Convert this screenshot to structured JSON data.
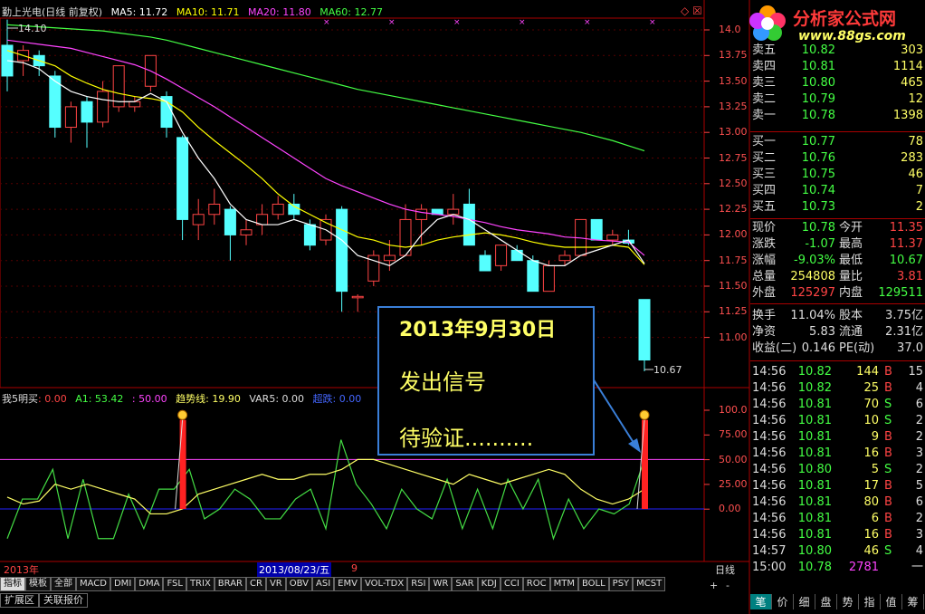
{
  "header": {
    "title": "勤上光电(日线 前复权)",
    "ma5": "MA5: 11.72",
    "ma10": "MA10: 11.71",
    "ma20": "MA20: 11.80",
    "ma60": "MA60: 12.77",
    "colors": {
      "ma5": "#ffffff",
      "ma10": "#ffff00",
      "ma20": "#ff44ff",
      "ma60": "#44ff44"
    }
  },
  "logo": {
    "name": "分析家公式网",
    "url": "www.88gs.com"
  },
  "indicator": {
    "name": "我5明买",
    "v1": ": 0.00",
    "a1": "A1: 53.42",
    "v2": ": 50.00",
    "trend": "趋势线: 19.90",
    "var5": "VAR5: 0.00",
    "other": "超跌: 0.00"
  },
  "price_axis": [
    "14.0",
    "13.75",
    "13.50",
    "13.25",
    "13.00",
    "12.75",
    "12.50",
    "12.25",
    "12.00",
    "11.75",
    "11.50",
    "11.25",
    "11.00"
  ],
  "ind_axis": [
    "100.0",
    "75.00",
    "50.00",
    "25.00",
    "0.00"
  ],
  "annotations": {
    "high": "14.10",
    "low": "10.67"
  },
  "note": {
    "line1": "2013年9月30日",
    "line2": "发出信号",
    "line3": "待验证.........."
  },
  "bottom": {
    "year": "2013年",
    "date": "2013/08/23/五",
    "mark": "9",
    "period": "日线",
    "plus": "+",
    "minus": "-"
  },
  "tabs": [
    "指标",
    "模板",
    "全部",
    "MACD",
    "DMI",
    "DMA",
    "FSL",
    "TRIX",
    "BRAR",
    "CR",
    "VR",
    "OBV",
    "ASI",
    "EMV",
    "VOL-TDX",
    "RSI",
    "WR",
    "SAR",
    "KDJ",
    "CCI",
    "ROC",
    "MTM",
    "BOLL",
    "PSY",
    "MCST"
  ],
  "tabs2": [
    "扩展区",
    "关联报价"
  ],
  "rtabs": [
    "笔",
    "价",
    "细",
    "盘",
    "势",
    "指",
    "值",
    "筹"
  ],
  "sells": [
    {
      "l": "卖五",
      "p": "10.82",
      "v": "303"
    },
    {
      "l": "卖四",
      "p": "10.81",
      "v": "1114"
    },
    {
      "l": "卖三",
      "p": "10.80",
      "v": "465"
    },
    {
      "l": "卖二",
      "p": "10.79",
      "v": "12"
    },
    {
      "l": "卖一",
      "p": "10.78",
      "v": "1398"
    }
  ],
  "buys": [
    {
      "l": "买一",
      "p": "10.77",
      "v": "78"
    },
    {
      "l": "买二",
      "p": "10.76",
      "v": "283"
    },
    {
      "l": "买三",
      "p": "10.75",
      "v": "46"
    },
    {
      "l": "买四",
      "p": "10.74",
      "v": "7"
    },
    {
      "l": "买五",
      "p": "10.73",
      "v": "2"
    }
  ],
  "quote": [
    {
      "l1": "现价",
      "v1": "10.78",
      "l2": "今开",
      "v2": "11.35",
      "c1": "#44ff44",
      "c2": "#ff4444"
    },
    {
      "l1": "涨跌",
      "v1": "-1.07",
      "l2": "最高",
      "v2": "11.37",
      "c1": "#44ff44",
      "c2": "#ff4444"
    },
    {
      "l1": "涨幅",
      "v1": "-9.03%",
      "l2": "最低",
      "v2": "10.67",
      "c1": "#44ff44",
      "c2": "#44ff44"
    },
    {
      "l1": "总量",
      "v1": "254808",
      "l2": "量比",
      "v2": "3.81",
      "c1": "#ffff66",
      "c2": "#ff4444"
    },
    {
      "l1": "外盘",
      "v1": "125297",
      "l2": "内盘",
      "v2": "129511",
      "c1": "#ff4444",
      "c2": "#44ff44"
    }
  ],
  "quote2": [
    {
      "l1": "换手",
      "v1": "11.04%",
      "l2": "股本",
      "v2": "3.75亿"
    },
    {
      "l1": "净资",
      "v1": "5.83",
      "l2": "流通",
      "v2": "2.31亿"
    },
    {
      "l1": "收益(二)",
      "v1": "0.146",
      "l2": "PE(动)",
      "v2": "37.0"
    }
  ],
  "ticks": [
    {
      "t": "14:56",
      "p": "10.82",
      "v": "144",
      "bs": "B",
      "n": "15"
    },
    {
      "t": "14:56",
      "p": "10.82",
      "v": "25",
      "bs": "B",
      "n": "4"
    },
    {
      "t": "14:56",
      "p": "10.81",
      "v": "70",
      "bs": "S",
      "n": "6"
    },
    {
      "t": "14:56",
      "p": "10.81",
      "v": "10",
      "bs": "S",
      "n": "2"
    },
    {
      "t": "14:56",
      "p": "10.81",
      "v": "9",
      "bs": "B",
      "n": "2"
    },
    {
      "t": "14:56",
      "p": "10.81",
      "v": "16",
      "bs": "B",
      "n": "3"
    },
    {
      "t": "14:56",
      "p": "10.80",
      "v": "5",
      "bs": "S",
      "n": "2"
    },
    {
      "t": "14:56",
      "p": "10.81",
      "v": "17",
      "bs": "B",
      "n": "5"
    },
    {
      "t": "14:56",
      "p": "10.81",
      "v": "80",
      "bs": "B",
      "n": "6"
    },
    {
      "t": "14:56",
      "p": "10.81",
      "v": "6",
      "bs": "B",
      "n": "2"
    },
    {
      "t": "14:56",
      "p": "10.81",
      "v": "16",
      "bs": "B",
      "n": "3"
    },
    {
      "t": "14:57",
      "p": "10.80",
      "v": "46",
      "bs": "S",
      "n": "4"
    },
    {
      "t": "15:00",
      "p": "10.78",
      "v": "2781",
      "bs": "",
      "n": "一"
    }
  ],
  "chart_data": {
    "type": "candlestick",
    "price_range": [
      10.6,
      14.15
    ],
    "candles": [
      {
        "o": 13.85,
        "h": 14.1,
        "l": 13.4,
        "c": 13.55
      },
      {
        "o": 13.7,
        "h": 13.85,
        "l": 13.55,
        "c": 13.8
      },
      {
        "o": 13.75,
        "h": 13.8,
        "l": 13.55,
        "c": 13.65
      },
      {
        "o": 13.55,
        "h": 13.6,
        "l": 12.95,
        "c": 13.05
      },
      {
        "o": 13.05,
        "h": 13.3,
        "l": 12.9,
        "c": 13.25
      },
      {
        "o": 13.3,
        "h": 13.35,
        "l": 12.85,
        "c": 13.1
      },
      {
        "o": 13.1,
        "h": 13.5,
        "l": 13.05,
        "c": 13.4
      },
      {
        "o": 13.25,
        "h": 13.65,
        "l": 13.2,
        "c": 13.65
      },
      {
        "o": 13.25,
        "h": 13.35,
        "l": 13.2,
        "c": 13.3
      },
      {
        "o": 13.45,
        "h": 13.75,
        "l": 13.4,
        "c": 13.75
      },
      {
        "o": 13.35,
        "h": 13.4,
        "l": 12.95,
        "c": 13.05
      },
      {
        "o": 12.95,
        "h": 12.97,
        "l": 11.95,
        "c": 12.15
      },
      {
        "o": 12.1,
        "h": 12.35,
        "l": 11.95,
        "c": 12.2
      },
      {
        "o": 12.2,
        "h": 12.45,
        "l": 12.1,
        "c": 12.3
      },
      {
        "o": 12.25,
        "h": 12.28,
        "l": 11.75,
        "c": 12.0
      },
      {
        "o": 12.0,
        "h": 12.15,
        "l": 11.9,
        "c": 12.05
      },
      {
        "o": 12.1,
        "h": 12.3,
        "l": 12.0,
        "c": 12.2
      },
      {
        "o": 12.2,
        "h": 12.38,
        "l": 12.15,
        "c": 12.3
      },
      {
        "o": 12.3,
        "h": 12.4,
        "l": 12.15,
        "c": 12.2
      },
      {
        "o": 12.1,
        "h": 12.15,
        "l": 11.85,
        "c": 11.9
      },
      {
        "o": 11.95,
        "h": 12.2,
        "l": 11.9,
        "c": 12.15
      },
      {
        "o": 12.25,
        "h": 12.28,
        "l": 11.25,
        "c": 11.45
      },
      {
        "o": 11.4,
        "h": 11.42,
        "l": 11.25,
        "c": 11.4
      },
      {
        "o": 11.55,
        "h": 11.85,
        "l": 11.5,
        "c": 11.8
      },
      {
        "o": 11.75,
        "h": 11.95,
        "l": 11.65,
        "c": 11.8
      },
      {
        "o": 11.8,
        "h": 12.3,
        "l": 11.8,
        "c": 12.15
      },
      {
        "o": 12.15,
        "h": 12.3,
        "l": 11.9,
        "c": 12.25
      },
      {
        "o": 12.25,
        "h": 12.25,
        "l": 12.2,
        "c": 12.2
      },
      {
        "o": 12.2,
        "h": 12.4,
        "l": 12.1,
        "c": 12.25
      },
      {
        "o": 12.3,
        "h": 12.45,
        "l": 11.9,
        "c": 11.9
      },
      {
        "o": 11.8,
        "h": 11.85,
        "l": 11.65,
        "c": 11.65
      },
      {
        "o": 11.7,
        "h": 11.9,
        "l": 11.65,
        "c": 11.9
      },
      {
        "o": 11.85,
        "h": 11.9,
        "l": 11.75,
        "c": 11.75
      },
      {
        "o": 11.75,
        "h": 11.8,
        "l": 11.45,
        "c": 11.45
      },
      {
        "o": 11.45,
        "h": 11.75,
        "l": 11.45,
        "c": 11.7
      },
      {
        "o": 11.75,
        "h": 11.85,
        "l": 11.7,
        "c": 11.8
      },
      {
        "o": 11.8,
        "h": 12.15,
        "l": 11.8,
        "c": 12.15
      },
      {
        "o": 12.15,
        "h": 12.15,
        "l": 11.95,
        "c": 11.95
      },
      {
        "o": 11.95,
        "h": 12.05,
        "l": 11.9,
        "c": 12.0
      },
      {
        "o": 11.95,
        "h": 12.05,
        "l": 11.9,
        "c": 11.92
      },
      {
        "o": 11.37,
        "h": 11.37,
        "l": 10.67,
        "c": 10.78
      }
    ],
    "ma5": [
      13.7,
      13.68,
      13.62,
      13.5,
      13.4,
      13.35,
      13.32,
      13.3,
      13.3,
      13.38,
      13.3,
      13.0,
      12.75,
      12.55,
      12.3,
      12.15,
      12.1,
      12.1,
      12.15,
      12.1,
      12.05,
      11.95,
      11.8,
      11.75,
      11.7,
      11.8,
      12.0,
      12.15,
      12.2,
      12.15,
      12.05,
      11.95,
      11.85,
      11.75,
      11.7,
      11.7,
      11.8,
      11.85,
      11.9,
      11.95,
      11.72
    ],
    "ma10": [
      13.8,
      13.75,
      13.7,
      13.65,
      13.55,
      13.48,
      13.42,
      13.38,
      13.35,
      13.33,
      13.3,
      13.2,
      13.05,
      12.92,
      12.8,
      12.68,
      12.55,
      12.4,
      12.28,
      12.2,
      12.12,
      12.05,
      11.98,
      11.95,
      11.9,
      11.88,
      11.9,
      11.95,
      11.98,
      12.0,
      12.02,
      12.0,
      11.97,
      11.93,
      11.9,
      11.88,
      11.88,
      11.88,
      11.9,
      11.88,
      11.71
    ],
    "ma20": [
      13.9,
      13.88,
      13.86,
      13.84,
      13.82,
      13.78,
      13.74,
      13.7,
      13.66,
      13.6,
      13.52,
      13.43,
      13.34,
      13.25,
      13.15,
      13.05,
      12.95,
      12.85,
      12.75,
      12.65,
      12.55,
      12.48,
      12.42,
      12.36,
      12.3,
      12.25,
      12.22,
      12.2,
      12.18,
      12.15,
      12.12,
      12.08,
      12.05,
      12.03,
      12.01,
      11.98,
      11.97,
      11.95,
      11.94,
      11.93,
      11.8
    ],
    "ma60": [
      14.05,
      14.04,
      14.03,
      14.02,
      14.01,
      14.0,
      13.99,
      13.97,
      13.95,
      13.93,
      13.9,
      13.86,
      13.82,
      13.78,
      13.74,
      13.7,
      13.66,
      13.62,
      13.58,
      13.54,
      13.5,
      13.46,
      13.42,
      13.39,
      13.36,
      13.33,
      13.3,
      13.27,
      13.24,
      13.21,
      13.18,
      13.15,
      13.12,
      13.09,
      13.06,
      13.03,
      13.0,
      12.96,
      12.92,
      12.87,
      12.82
    ],
    "ind_range": [
      -50,
      120
    ],
    "green": [
      -30,
      10,
      10,
      40,
      -30,
      30,
      -30,
      -30,
      15,
      -20,
      20,
      20,
      40,
      -10,
      0,
      20,
      10,
      -10,
      -10,
      10,
      20,
      -20,
      70,
      25,
      5,
      -20,
      20,
      0,
      -10,
      30,
      -20,
      20,
      -20,
      30,
      0,
      30,
      -30,
      10,
      -20,
      0,
      -5,
      5,
      50
    ],
    "yellow": [
      12,
      5,
      8,
      25,
      20,
      25,
      20,
      15,
      10,
      -5,
      -5,
      0,
      15,
      20,
      25,
      30,
      35,
      30,
      30,
      35,
      35,
      40,
      50,
      50,
      45,
      40,
      35,
      30,
      25,
      35,
      30,
      25,
      30,
      35,
      40,
      35,
      20,
      10,
      5,
      10,
      20
    ],
    "signals": [
      11,
      40
    ]
  }
}
